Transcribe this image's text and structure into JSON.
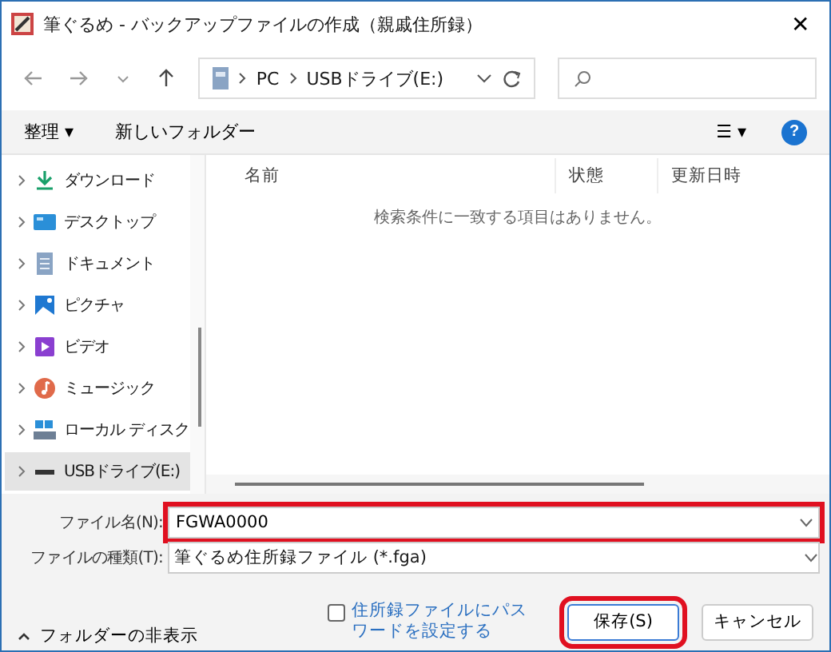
{
  "window": {
    "title": "筆ぐるめ - バックアップファイルの作成（親戚住所録）",
    "close": "✕"
  },
  "nav": {
    "path": [
      {
        "label": "PC"
      },
      {
        "label": "USBドライブ(E:)"
      }
    ]
  },
  "toolbar": {
    "organize": "整理 ▾",
    "new_folder": "新しいフォルダー",
    "view": "☰ ▾",
    "help": "?"
  },
  "sidebar": {
    "items": [
      {
        "label": "ダウンロード",
        "kind": "download",
        "selected": false
      },
      {
        "label": "デスクトップ",
        "kind": "desktop",
        "selected": false
      },
      {
        "label": "ドキュメント",
        "kind": "document",
        "selected": false
      },
      {
        "label": "ピクチャ",
        "kind": "picture",
        "selected": false
      },
      {
        "label": "ビデオ",
        "kind": "video",
        "selected": false
      },
      {
        "label": "ミュージック",
        "kind": "music",
        "selected": false
      },
      {
        "label": "ローカル ディスク",
        "kind": "disk",
        "selected": false
      },
      {
        "label": "USBドライブ(E:)",
        "kind": "usb",
        "selected": true
      }
    ]
  },
  "table": {
    "columns": [
      "名前",
      "状態",
      "更新日時"
    ],
    "empty_message": "検索条件に一致する項目はありません。"
  },
  "form": {
    "file_name": {
      "label": "ファイル名(N):",
      "value": "FGWA0000",
      "highlighted": true
    },
    "file_type": {
      "label": "ファイルの種類(T):",
      "value": "筆ぐるめ住所録ファイル (*.fga)",
      "highlighted": false
    }
  },
  "footer": {
    "hide_folders": "フォルダーの非表示",
    "password": {
      "label": "住所録ファイルにパスワードを設定する",
      "checked": false
    },
    "buttons": [
      {
        "label": "保存(S)",
        "highlighted": true
      },
      {
        "label": "キャンセル",
        "highlighted": false
      }
    ]
  }
}
